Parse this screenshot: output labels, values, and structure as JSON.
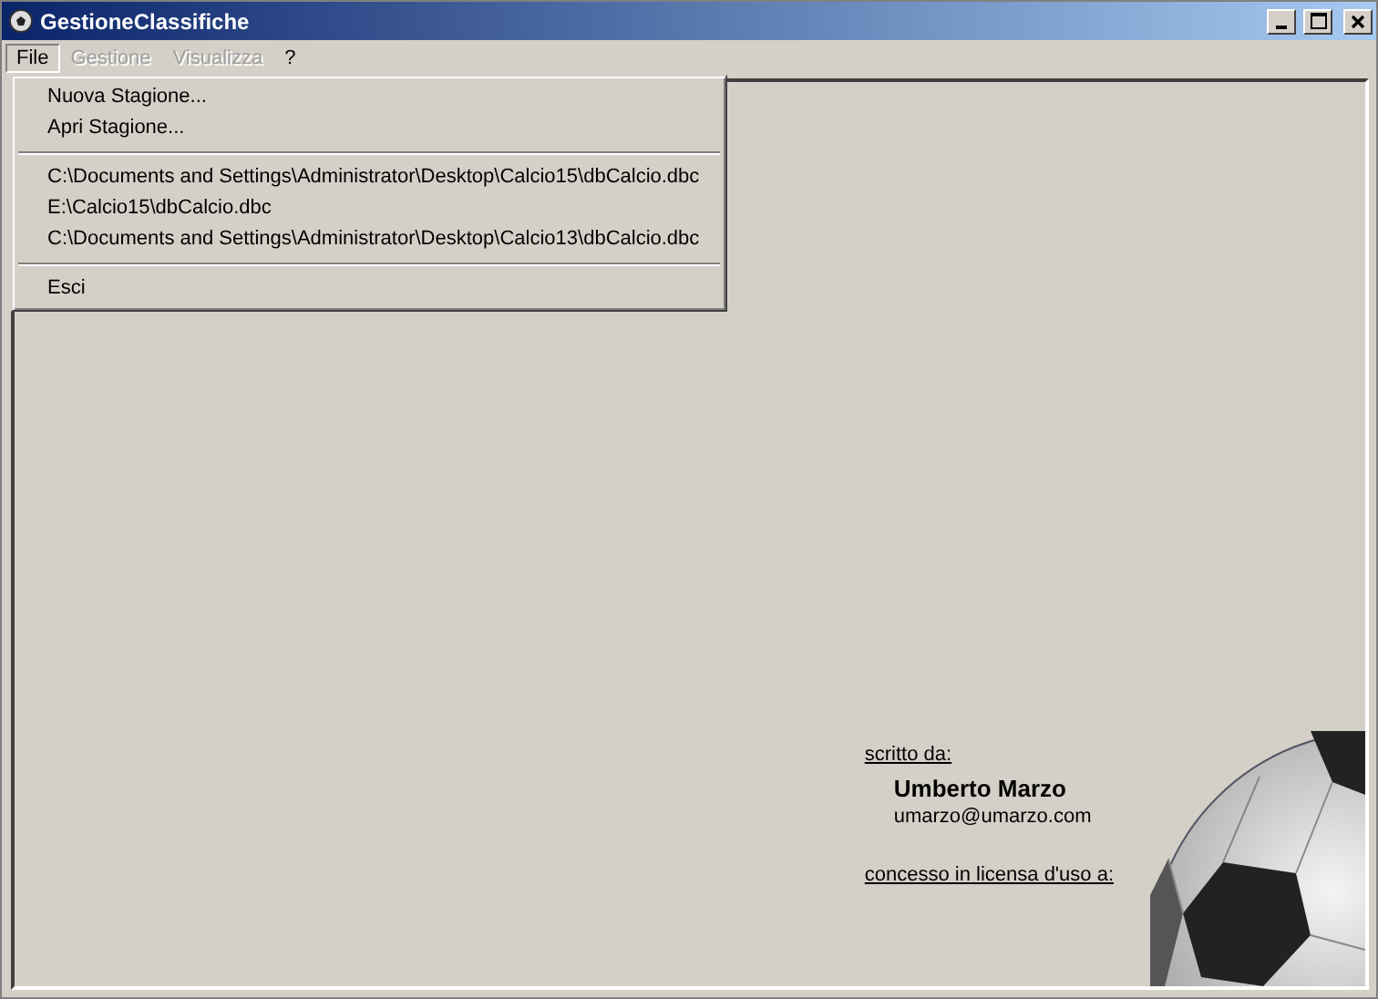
{
  "window": {
    "title": "GestioneClassifiche"
  },
  "menu_bar": [
    {
      "label": "File",
      "selected": true,
      "disabled": false
    },
    {
      "label": "Gestione",
      "selected": false,
      "disabled": true
    },
    {
      "label": "Visualizza",
      "selected": false,
      "disabled": true
    },
    {
      "label": "?",
      "selected": false,
      "disabled": false
    }
  ],
  "file_menu": [
    {
      "kind": "item",
      "label": "Nuova Stagione..."
    },
    {
      "kind": "item",
      "label": "Apri Stagione..."
    },
    {
      "kind": "separator"
    },
    {
      "kind": "item",
      "label": "C:\\Documents and Settings\\Administrator\\Desktop\\Calcio15\\dbCalcio.dbc"
    },
    {
      "kind": "item",
      "label": "E:\\Calcio15\\dbCalcio.dbc"
    },
    {
      "kind": "item",
      "label": "C:\\Documents and Settings\\Administrator\\Desktop\\Calcio13\\dbCalcio.dbc"
    },
    {
      "kind": "separator"
    },
    {
      "kind": "item",
      "label": "Esci"
    }
  ],
  "credits": {
    "written_by_label": "scritto da:",
    "author": "Umberto Marzo",
    "email": "umarzo@umarzo.com",
    "licensed_to_label": "concesso in licensa d'uso a:"
  }
}
